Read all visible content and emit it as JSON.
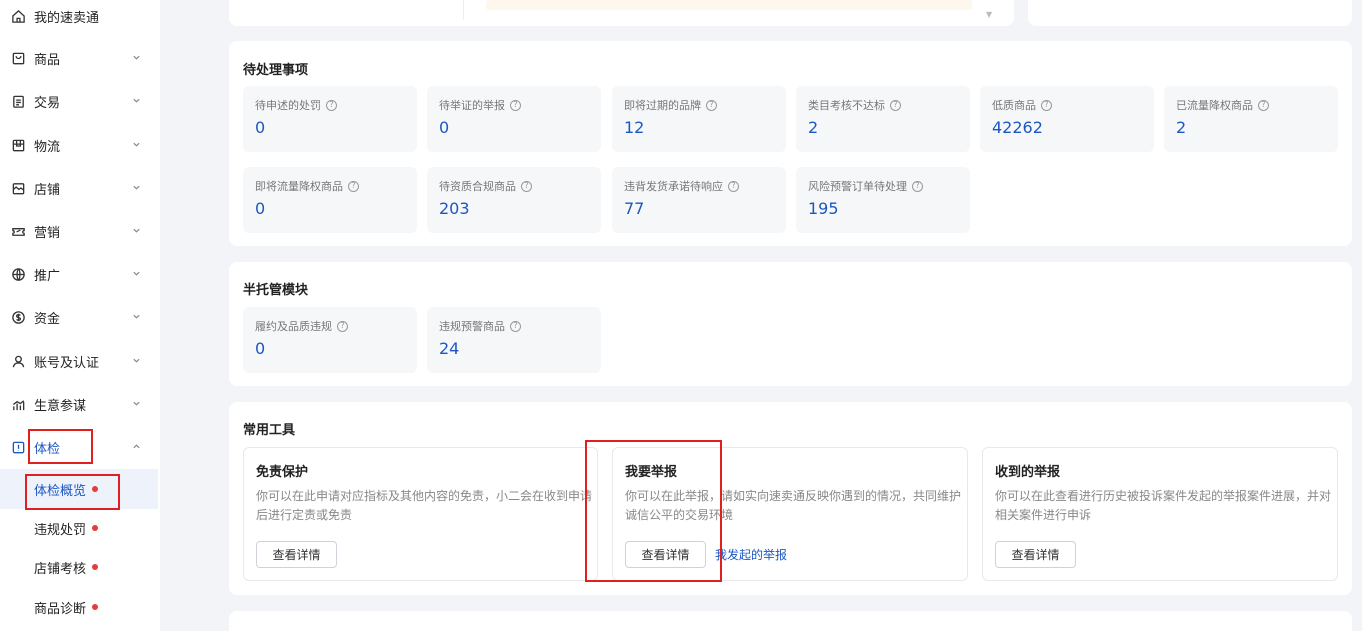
{
  "sidebar": {
    "items": [
      {
        "label": "我的速卖通",
        "icon": "home-icon"
      },
      {
        "label": "商品",
        "icon": "bag-icon"
      },
      {
        "label": "交易",
        "icon": "clipboard-icon"
      },
      {
        "label": "物流",
        "icon": "box-icon"
      },
      {
        "label": "店铺",
        "icon": "shop-icon"
      },
      {
        "label": "营销",
        "icon": "ticket-icon"
      },
      {
        "label": "推广",
        "icon": "globe-icon"
      },
      {
        "label": "资金",
        "icon": "dollar-icon"
      },
      {
        "label": "账号及认证",
        "icon": "user-icon"
      },
      {
        "label": "生意参谋",
        "icon": "bar-chart-icon"
      },
      {
        "label": "体检",
        "icon": "alert-icon"
      }
    ],
    "sub_items": [
      {
        "label": "体检概览"
      },
      {
        "label": "违规处罚"
      },
      {
        "label": "店铺考核"
      },
      {
        "label": "商品诊断"
      }
    ]
  },
  "pending": {
    "title": "待处理事项",
    "stats": [
      {
        "label": "待申述的处罚",
        "value": "0"
      },
      {
        "label": "待举证的举报",
        "value": "0"
      },
      {
        "label": "即将过期的品牌",
        "value": "12"
      },
      {
        "label": "类目考核不达标",
        "value": "2"
      },
      {
        "label": "低质商品",
        "value": "42262"
      },
      {
        "label": "已流量降权商品",
        "value": "2"
      },
      {
        "label": "即将流量降权商品",
        "value": "0"
      },
      {
        "label": "待资质合规商品",
        "value": "203"
      },
      {
        "label": "违背发货承诺待响应",
        "value": "77"
      },
      {
        "label": "风险预警订单待处理",
        "value": "195"
      }
    ]
  },
  "semi": {
    "title": "半托管模块",
    "stats": [
      {
        "label": "履约及品质违规",
        "value": "0"
      },
      {
        "label": "违规预警商品",
        "value": "24"
      }
    ]
  },
  "tools": {
    "title": "常用工具",
    "items": [
      {
        "title": "免责保护",
        "desc": "你可以在此申请对应指标及其他内容的免责，小二会在收到申请后进行定责或免责",
        "button": "查看详情"
      },
      {
        "title": "我要举报",
        "desc": "你可以在此举报，请如实向速卖通反映你遇到的情况，共同维护诚信公平的交易环境",
        "button": "查看详情",
        "link": "我发起的举报"
      },
      {
        "title": "收到的举报",
        "desc": "你可以在此查看进行历史被投诉案件发起的举报案件进展，并对相关案件进行申诉",
        "button": "查看详情"
      }
    ]
  },
  "colors": {
    "accent": "#1b57c2",
    "annotation": "#e02020",
    "dot": "#e23c3c"
  }
}
